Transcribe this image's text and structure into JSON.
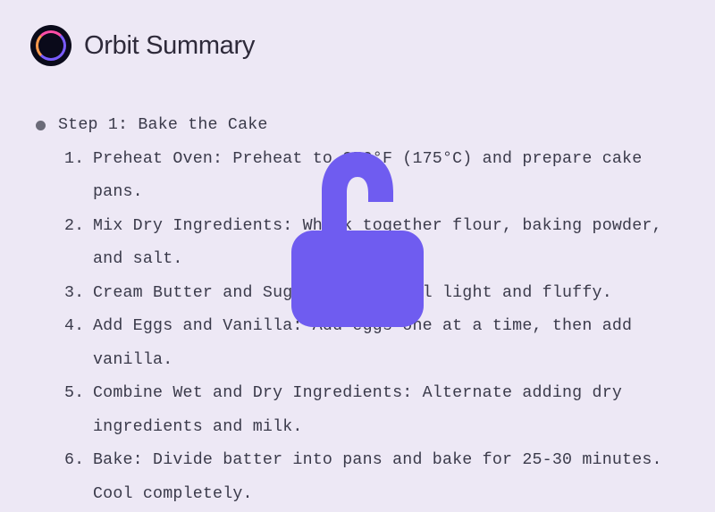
{
  "header": {
    "title": "Orbit Summary"
  },
  "main": {
    "step_title": "Step 1: Bake the Cake",
    "steps": [
      "Preheat Oven: Preheat to 350°F (175°C) and prepare cake pans.",
      "Mix Dry Ingredients: Whisk together flour, baking powder, and salt.",
      "Cream Butter and Sugar: Beat until light and fluffy.",
      "Add Eggs and Vanilla: Add eggs one at a time, then add vanilla.",
      "Combine Wet and Dry Ingredients: Alternate adding dry ingredients and milk.",
      "Bake: Divide batter into pans and bake for 25-30 minutes. Cool completely."
    ]
  },
  "overlay": {
    "icon": "lock-icon",
    "color": "#6f5cf0"
  }
}
